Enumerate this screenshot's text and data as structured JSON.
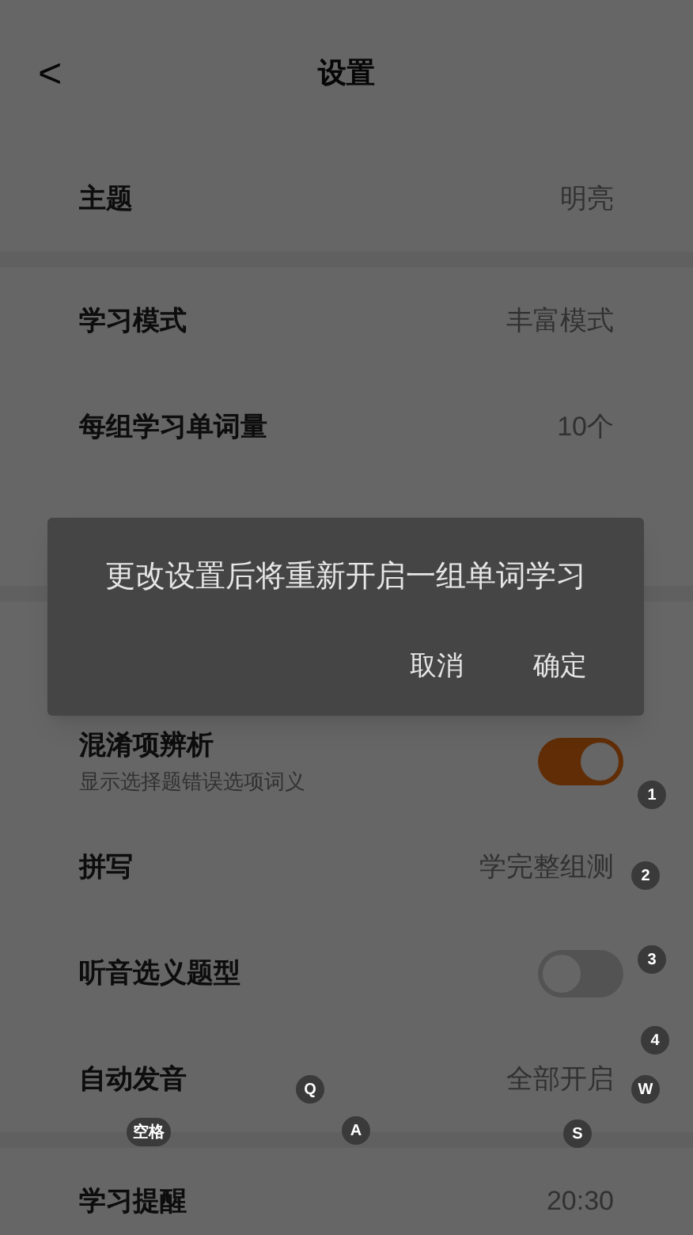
{
  "header": {
    "back": "<",
    "title": "设置"
  },
  "sections": [
    {
      "rows": [
        {
          "kind": "value",
          "label": "主题",
          "value": "明亮"
        }
      ]
    },
    {
      "rows": [
        {
          "kind": "value",
          "label": "学习模式",
          "value": "丰富模式"
        },
        {
          "kind": "value",
          "label": "每组学习单词量",
          "value": "10个"
        },
        {
          "kind": "blank"
        }
      ]
    },
    {
      "rows": [
        {
          "kind": "blank"
        },
        {
          "kind": "toggle",
          "label": "混淆项辨析",
          "subtitle": "显示选择题错误选项词义",
          "on": true
        },
        {
          "kind": "value",
          "label": "拼写",
          "value": "学完整组测"
        },
        {
          "kind": "toggle",
          "label": "听音选义题型",
          "on": false
        },
        {
          "kind": "value",
          "label": "自动发音",
          "value": "全部开启"
        }
      ]
    },
    {
      "rows": [
        {
          "kind": "value",
          "label": "学习提醒",
          "value": "20:30"
        }
      ]
    }
  ],
  "dialog": {
    "message": "更改设置后将重新开启一组单词学习",
    "buttons": [
      "取消",
      "确定"
    ]
  },
  "key_hints": [
    "1",
    "2",
    "3",
    "4",
    "Q",
    "W",
    "空格",
    "A",
    "S"
  ]
}
